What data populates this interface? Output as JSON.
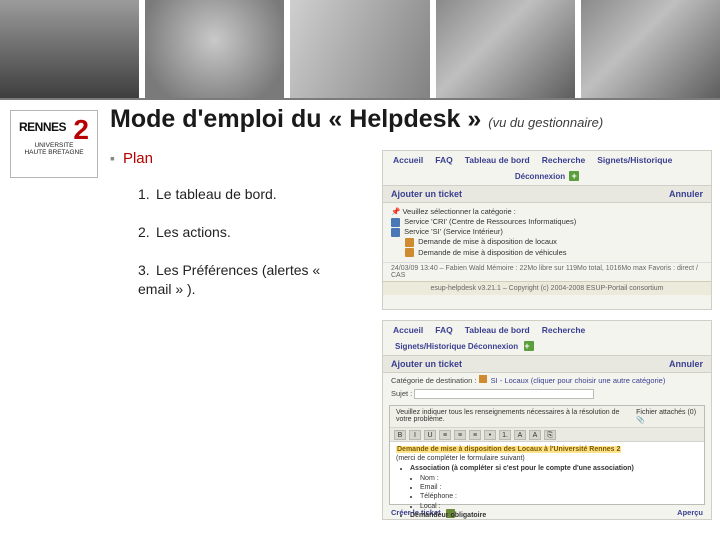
{
  "logo": {
    "text_rennes": "RENNES",
    "text_two": "2",
    "text_univ": "UNIVERSITE",
    "text_hb": "HAUTE BRETAGNE"
  },
  "title": {
    "main": "Mode d'emploi du « Helpdesk »",
    "sub": "(vu du gestionnaire)"
  },
  "plan": {
    "heading": "Plan",
    "items": [
      {
        "num": "1.",
        "text": "Le tableau de bord."
      },
      {
        "num": "2.",
        "text": "Les actions."
      },
      {
        "num": "3.",
        "text": "Les Préférences (alertes « email » )."
      }
    ]
  },
  "mock1": {
    "nav": [
      "Accueil",
      "FAQ",
      "Tableau de bord",
      "Recherche",
      "Signets/Historique"
    ],
    "subnav": "Déconnexion",
    "bar_left": "Ajouter un ticket",
    "bar_right": "Annuler",
    "prompt": "Veuillez sélectionner la catégorie :",
    "tree": [
      {
        "level": 1,
        "text": "Service 'CRI' (Centre de Ressources Informatiques)"
      },
      {
        "level": 1,
        "text": "Service 'SI' (Service Intérieur)"
      },
      {
        "level": 2,
        "text": "Demande de mise à disposition de locaux"
      },
      {
        "level": 2,
        "text": "Demande de mise à disposition de véhicules"
      }
    ],
    "status": "24/03/09 13:40 – Fabien Wald   Mémoire : 22Mo libre sur 119Mo total, 1016Mo max   Favoris : direct / CAS",
    "copyright": "esup-helpdesk v3.21.1 – Copyright (c) 2004-2008 ESUP-Portail consortium"
  },
  "mock2": {
    "nav": [
      "Accueil",
      "FAQ",
      "Tableau de bord",
      "Recherche"
    ],
    "subnav": "Signets/Historique    Déconnexion",
    "bar_left": "Ajouter un ticket",
    "bar_right": "Annuler",
    "field_cat_label": "Catégorie de destination :",
    "field_cat_value": "SI - Locaux (cliquer pour choisir une autre catégorie)",
    "field_subj_label": "Sujet :",
    "editor_head_left": "Veuillez indiquer tous les renseignements nécessaires à la résolution de votre problème.",
    "editor_head_right": "Fichier attachés (0)",
    "toolbar_buttons": [
      "B",
      "I",
      "U",
      "≡",
      "≡",
      "≡",
      "•",
      "1.",
      "A",
      "A",
      "⎘"
    ],
    "editor_highlight": "Demande de mise à disposition des Locaux à l'Université Rennes 2",
    "editor_note": "(merci de compléter le formulaire suivant)",
    "editor_list_head": "Association (à compléter si c'est pour le compte d'une association)",
    "editor_list": [
      "Nom :",
      "Email :",
      "Téléphone :",
      "Local :"
    ],
    "editor_list2_head": "Demandeur obligatoire",
    "footer_left": "Créer le ticket",
    "footer_right": "Aperçu"
  }
}
